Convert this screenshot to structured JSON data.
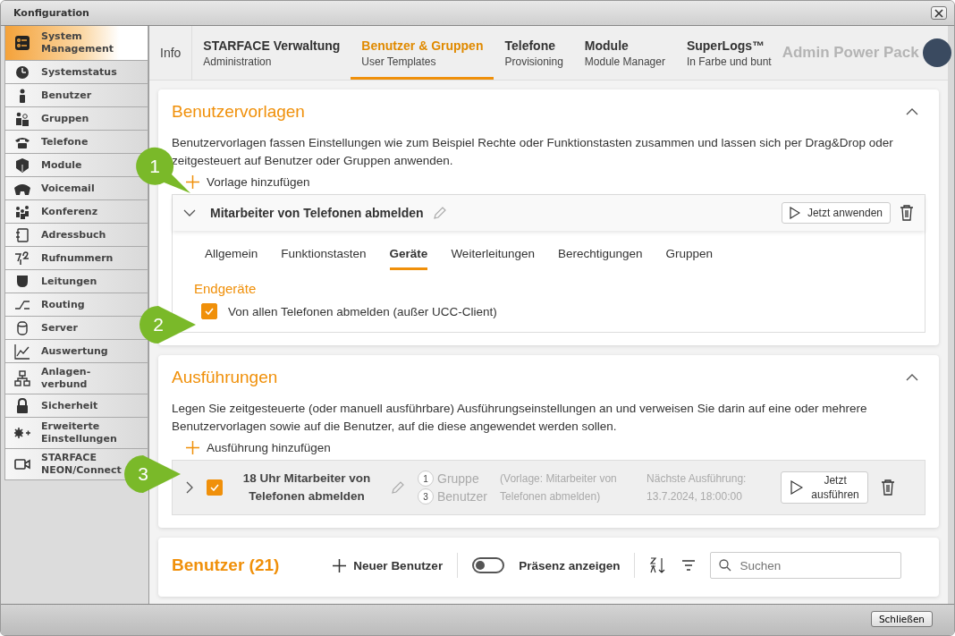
{
  "window": {
    "title": "Konfiguration"
  },
  "sidebar": {
    "items": [
      {
        "label": "System\nManagement",
        "selected": true
      },
      {
        "label": "Systemstatus",
        "selected": false
      },
      {
        "label": "Benutzer",
        "selected": false
      },
      {
        "label": "Gruppen",
        "selected": false
      },
      {
        "label": "Telefone",
        "selected": false
      },
      {
        "label": "Module",
        "selected": false
      },
      {
        "label": "Voicemail",
        "selected": false
      },
      {
        "label": "Konferenz",
        "selected": false
      },
      {
        "label": "Adressbuch",
        "selected": false
      },
      {
        "label": "Rufnummern",
        "selected": false
      },
      {
        "label": "Leitungen",
        "selected": false
      },
      {
        "label": "Routing",
        "selected": false
      },
      {
        "label": "Server",
        "selected": false
      },
      {
        "label": "Auswertung",
        "selected": false
      },
      {
        "label": "Anlagen-\nverbund",
        "selected": false
      },
      {
        "label": "Sicherheit",
        "selected": false
      },
      {
        "label": "Erweiterte\nEinstellungen",
        "selected": false
      },
      {
        "label": "STARFACE\nNEON/Connect",
        "selected": false
      }
    ]
  },
  "nav": {
    "info": "Info",
    "tabs": [
      {
        "title": "STARFACE Verwaltung",
        "subtitle": "Administration",
        "selected": false
      },
      {
        "title": "Benutzer & Gruppen",
        "subtitle": "User Templates",
        "selected": true
      },
      {
        "title": "Telefone",
        "subtitle": "Provisioning",
        "selected": false
      },
      {
        "title": "Module",
        "subtitle": "Module Manager",
        "selected": false
      },
      {
        "title": "SuperLogs™",
        "subtitle": "In Farbe und bunt",
        "selected": false
      }
    ],
    "watermark": "Admin Power Pack"
  },
  "templates": {
    "title": "Benutzervorlagen",
    "description": "Benutzervorlagen fassen Einstellungen wie zum Beispiel Rechte oder Funktionstasten zusammen und lassen sich per Drag&Drop oder zeitgesteuert auf Benutzer oder Gruppen anwenden.",
    "add_label": "Vorlage hinzufügen",
    "template": {
      "name": "Mitarbeiter von Telefonen abmelden",
      "expanded": true,
      "apply_label": "Jetzt anwenden",
      "tabs": [
        {
          "label": "Allgemein",
          "selected": false
        },
        {
          "label": "Funktionstasten",
          "selected": false
        },
        {
          "label": "Geräte",
          "selected": true
        },
        {
          "label": "Weiterleitungen",
          "selected": false
        },
        {
          "label": "Berechtigungen",
          "selected": false
        },
        {
          "label": "Gruppen",
          "selected": false
        }
      ],
      "section_title": "Endgeräte",
      "option": {
        "label": "Von allen Telefonen abmelden (außer UCC-Client)",
        "checked": true
      }
    }
  },
  "executions": {
    "title": "Ausführungen",
    "description": "Legen Sie zeitgesteuerte (oder manuell ausführbare) Ausführungseinstellungen an und verweisen Sie darin auf eine oder mehrere Benutzervorlagen sowie auf die Benutzer, auf die diese angewendet werden sollen.",
    "add_label": "Ausführung hinzufügen",
    "items": [
      {
        "name": "18 Uhr Mitarbeiter von Telefonen abmelden",
        "checked": true,
        "expanded": false,
        "groups_count": "1",
        "groups_label": "Gruppe",
        "users_count": "3",
        "users_label": "Benutzer",
        "template_note": "(Vorlage: Mitarbeiter von Telefonen abmelden)",
        "next_label": "Nächste Ausführung:",
        "next_time": "13.7.2024, 18:00:00",
        "run_label": "Jetzt ausführen"
      }
    ]
  },
  "users": {
    "title": "Benutzer (21)",
    "new_label": "Neuer Benutzer",
    "presence": {
      "label": "Präsenz anzeigen",
      "on": false
    },
    "search": {
      "placeholder": "Suchen"
    }
  },
  "callouts": [
    {
      "number": "1"
    },
    {
      "number": "2"
    },
    {
      "number": "3"
    }
  ],
  "footer": {
    "close_label": "Schließen"
  }
}
